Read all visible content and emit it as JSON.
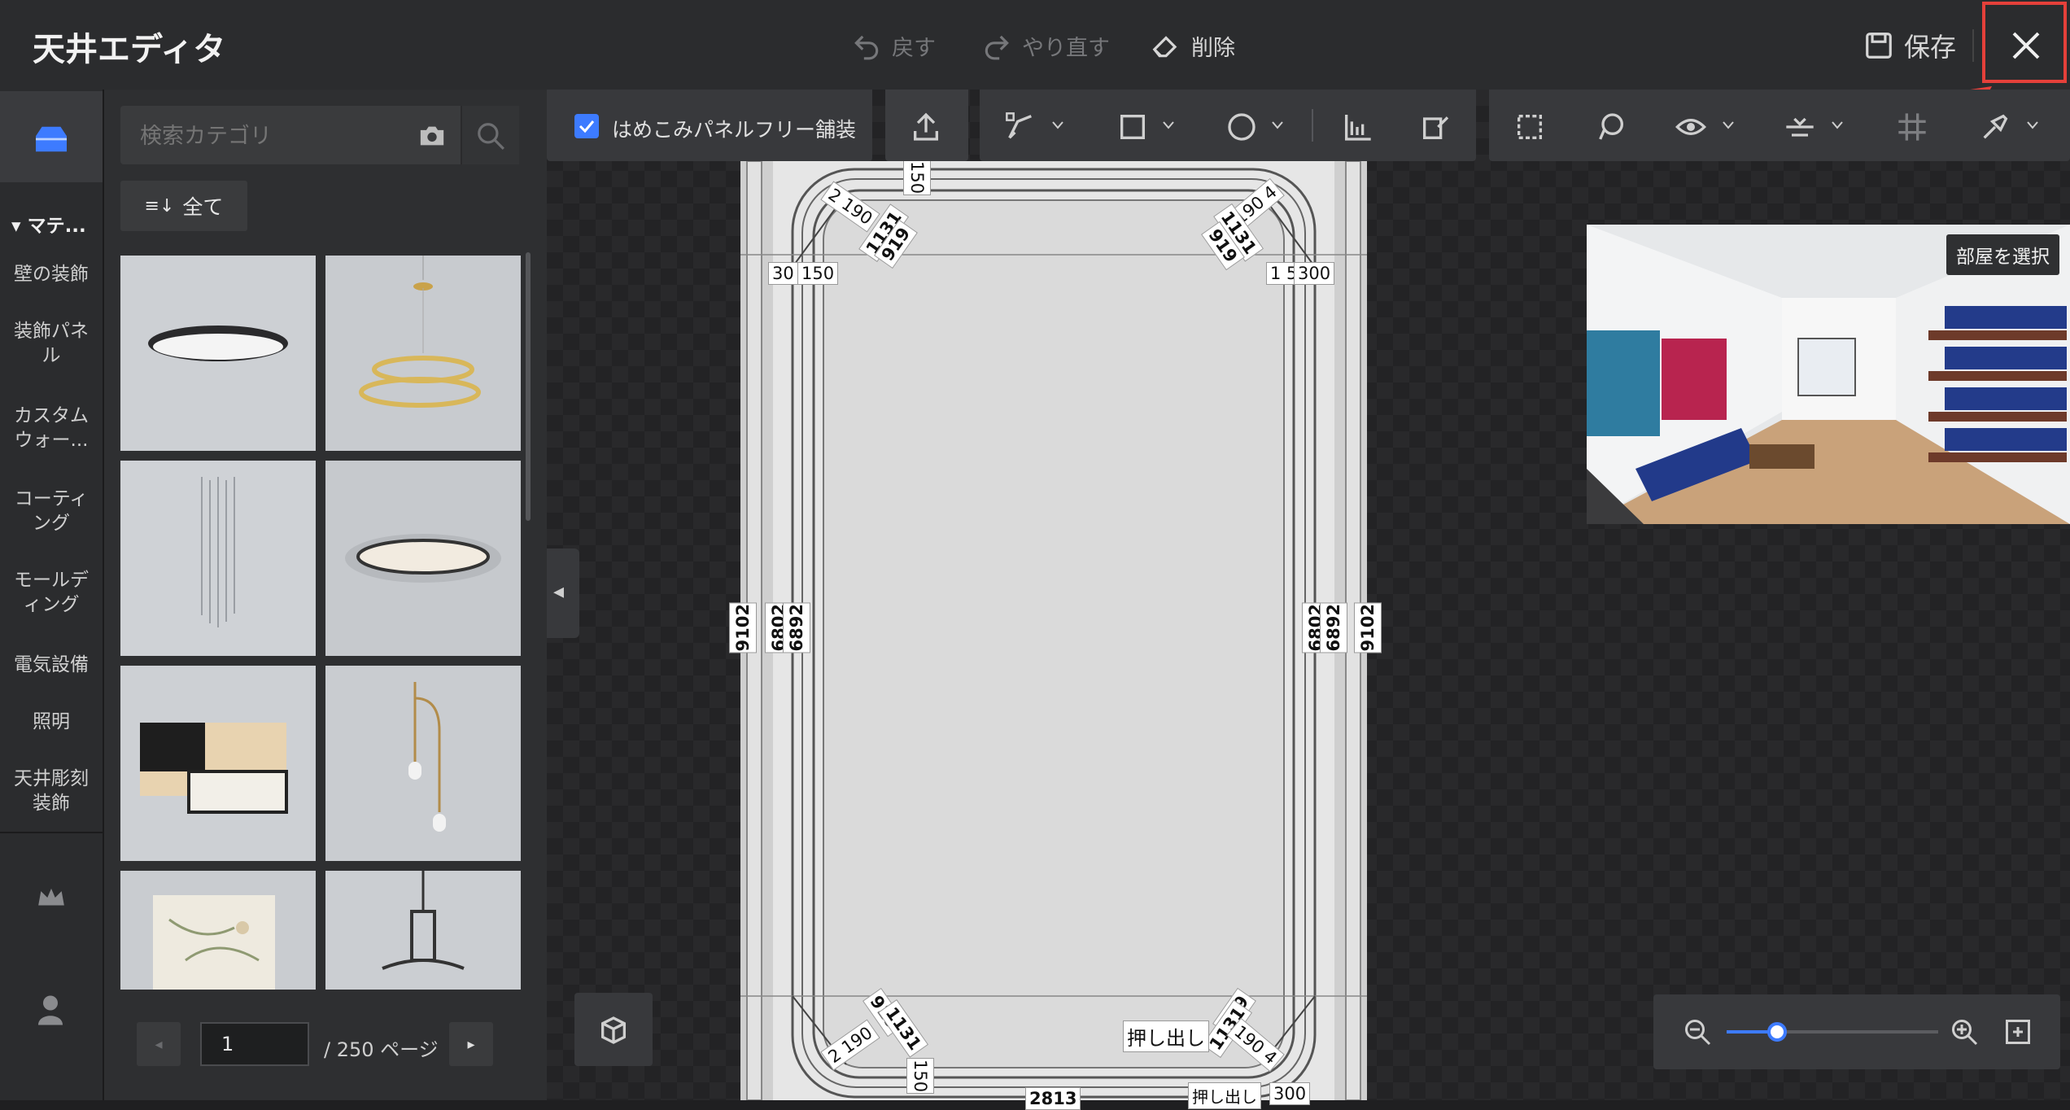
{
  "header": {
    "title": "天井エディタ",
    "undo_label": "戻す",
    "redo_label": "やり直す",
    "delete_label": "削除",
    "save_label": "保存"
  },
  "rail": {
    "section_label": "マテ...",
    "items": [
      {
        "label": "壁の装飾"
      },
      {
        "label": "装飾パネル"
      },
      {
        "label": "カスタムウォー..."
      },
      {
        "label": "コーティング"
      },
      {
        "label": "モールディング"
      },
      {
        "label": "電気設備"
      },
      {
        "label": "照明"
      },
      {
        "label": "天井彫刻装飾"
      }
    ]
  },
  "catalog": {
    "search_placeholder": "検索カテゴリ",
    "filter_label": "全て",
    "items": [
      {
        "icon": "round-flat-ceiling-light"
      },
      {
        "icon": "gold-ring-pendant"
      },
      {
        "icon": "crystal-chandelier"
      },
      {
        "icon": "ring-ceiling-light"
      },
      {
        "icon": "wood-panel-light"
      },
      {
        "icon": "single-pendant"
      },
      {
        "icon": "floral-shade-lamp"
      },
      {
        "icon": "black-chandelier"
      }
    ]
  },
  "pager": {
    "current_page": "1",
    "total_label": "/ 250 ページ"
  },
  "toolbar": {
    "checkbox_label": "はめこみパネルフリー舗装",
    "checkbox_checked": true
  },
  "preview": {
    "label": "部屋を選択"
  },
  "dimensions": {
    "top": "150",
    "corner_tl": "2 190",
    "corner_tr": "190 4",
    "d_1131": "1131",
    "d_919": "919",
    "left_a": "30",
    "left_b": "150",
    "right_a": "1 5",
    "right_b": "300",
    "side_outer": "9102",
    "side_inner_a": "6802",
    "side_inner_b": "6892",
    "bottom_extrude": "押し出し",
    "bottom_300": "300",
    "bottom_mid": "2813"
  },
  "colors": {
    "accent": "#3d7bff",
    "highlight": "#e5403a",
    "header_bg": "#2b2c2e"
  }
}
